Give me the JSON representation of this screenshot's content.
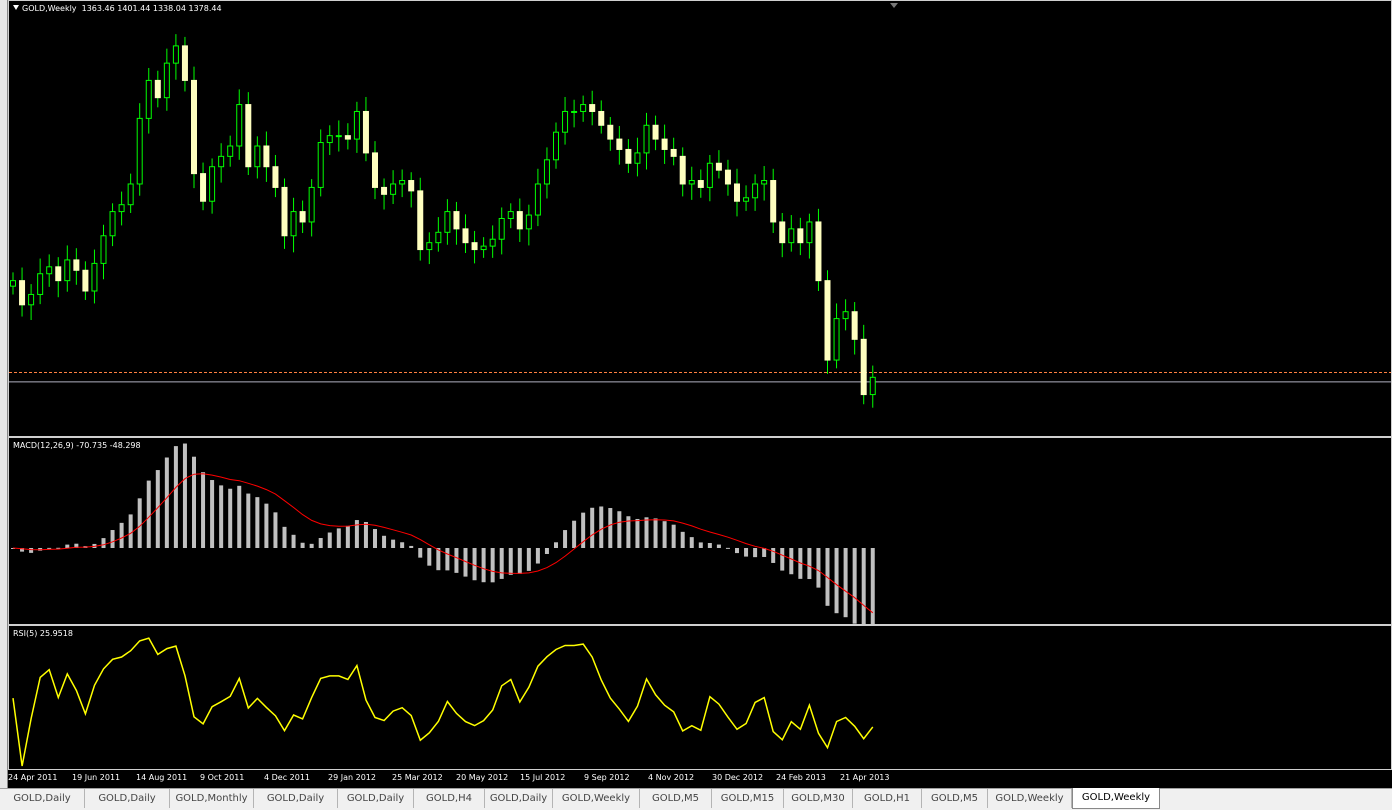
{
  "price_panel": {
    "symbol": "GOLD,Weekly",
    "ohlc": "1363.46 1401.44 1338.04 1378.44"
  },
  "macd_panel": {
    "label": "MACD(12,26,9) -70.735 -48.298"
  },
  "rsi_panel": {
    "label": "RSI(5) 25.9518"
  },
  "x_axis": [
    "24 Apr 2011",
    "19 Jun 2011",
    "14 Aug 2011",
    "9 Oct 2011",
    "4 Dec 2011",
    "29 Jan 2012",
    "25 Mar 2012",
    "20 May 2012",
    "15 Jul 2012",
    "9 Sep 2012",
    "4 Nov 2012",
    "30 Dec 2012",
    "24 Feb 2013",
    "21 Apr 2013"
  ],
  "tabs": [
    {
      "label": "GOLD,Daily"
    },
    {
      "label": "GOLD,Daily"
    },
    {
      "label": "GOLD,Monthly"
    },
    {
      "label": "GOLD,Daily"
    },
    {
      "label": "GOLD,Daily"
    },
    {
      "label": "GOLD,H4"
    },
    {
      "label": "GOLD,Daily"
    },
    {
      "label": "GOLD,Weekly"
    },
    {
      "label": "GOLD,M5"
    },
    {
      "label": "GOLD,M15"
    },
    {
      "label": "GOLD,M30"
    },
    {
      "label": "GOLD,H1"
    },
    {
      "label": "GOLD,M5"
    },
    {
      "label": "GOLD,Weekly"
    },
    {
      "label": "GOLD,Weekly",
      "active": true
    }
  ],
  "colors": {
    "background": "#000000",
    "candle_up": "#ffffff",
    "candle_down": "#ffffc0",
    "wick": "#00ff00",
    "macd_hist": "#c0c0c0",
    "signal": "#ff0000",
    "rsi": "#ffff00",
    "bid_line": "#b0b0c0",
    "ask_line": "#ff8040"
  },
  "chart_data": {
    "type": "candlestick",
    "interval": "weekly",
    "first_bar_week": "24 Apr 2011",
    "last_bar_ohlc": [
      1363.46,
      1401.44,
      1338.04,
      1378.44
    ],
    "closes": [
      1525,
      1490,
      1505,
      1535,
      1545,
      1525,
      1555,
      1540,
      1510,
      1550,
      1590,
      1625,
      1635,
      1665,
      1760,
      1815,
      1790,
      1840,
      1865,
      1815,
      1680,
      1640,
      1690,
      1705,
      1720,
      1780,
      1690,
      1720,
      1690,
      1660,
      1590,
      1625,
      1610,
      1660,
      1725,
      1735,
      1735,
      1730,
      1770,
      1710,
      1660,
      1650,
      1665,
      1670,
      1655,
      1570,
      1580,
      1595,
      1625,
      1600,
      1580,
      1570,
      1575,
      1585,
      1615,
      1625,
      1600,
      1620,
      1665,
      1700,
      1740,
      1770,
      1770,
      1780,
      1770,
      1750,
      1730,
      1715,
      1695,
      1710,
      1750,
      1730,
      1715,
      1705,
      1665,
      1670,
      1660,
      1695,
      1685,
      1665,
      1640,
      1645,
      1665,
      1670,
      1610,
      1580,
      1600,
      1580,
      1610,
      1525,
      1410,
      1470,
      1480,
      1440,
      1360,
      1385
    ]
  }
}
